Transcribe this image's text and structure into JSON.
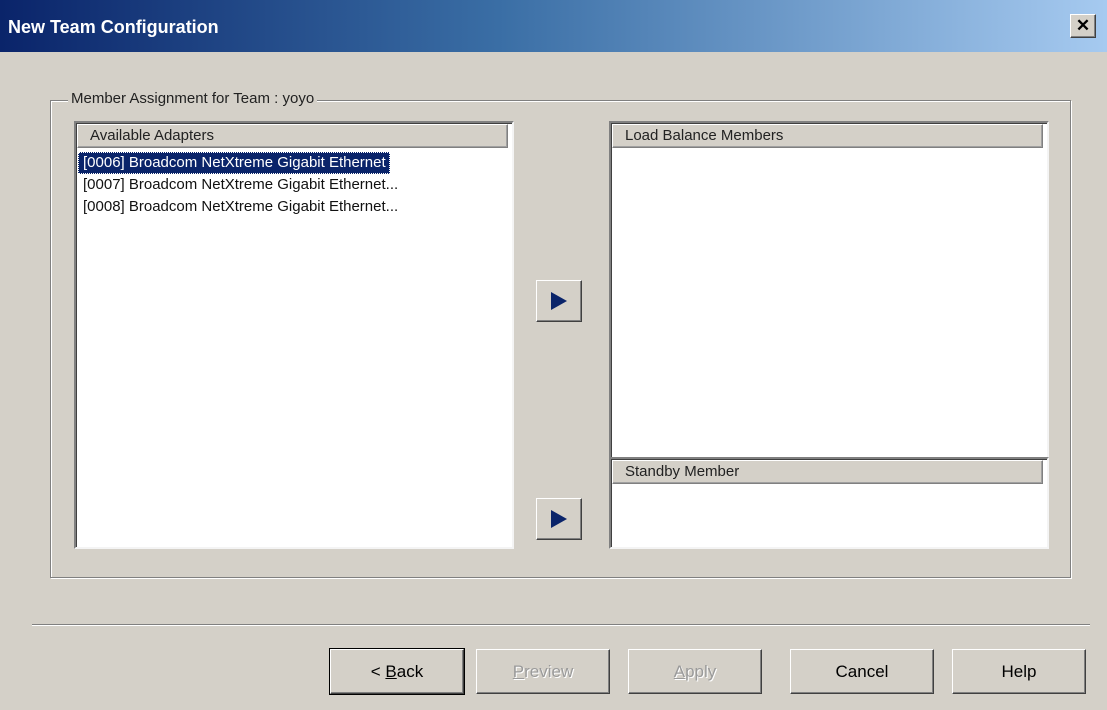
{
  "window": {
    "title": "New Team Configuration",
    "close_glyph": "✕"
  },
  "group": {
    "label": "Member Assignment for Team : yoyo"
  },
  "available": {
    "header": "Available Adapters",
    "items": [
      "[0006] Broadcom NetXtreme Gigabit Ethernet",
      "[0007] Broadcom NetXtreme Gigabit Ethernet...",
      "[0008] Broadcom NetXtreme Gigabit Ethernet..."
    ],
    "selected_index": 0
  },
  "load_balance": {
    "header": "Load Balance Members"
  },
  "standby": {
    "header": "Standby Member"
  },
  "buttons": {
    "back_prefix": "< ",
    "back_accel": "B",
    "back_rest": "ack",
    "preview_accel": "P",
    "preview_rest": "review",
    "apply_accel": "A",
    "apply_rest": "pply",
    "cancel": "Cancel",
    "help": "Help"
  },
  "icons": {
    "add_member": "right-triangle-icon",
    "add_standby": "right-triangle-icon",
    "close": "close-icon"
  },
  "colors": {
    "title_start": "#0a246a",
    "title_end": "#a6caf0",
    "selection": "#0a246a",
    "face": "#d4d0c8"
  }
}
